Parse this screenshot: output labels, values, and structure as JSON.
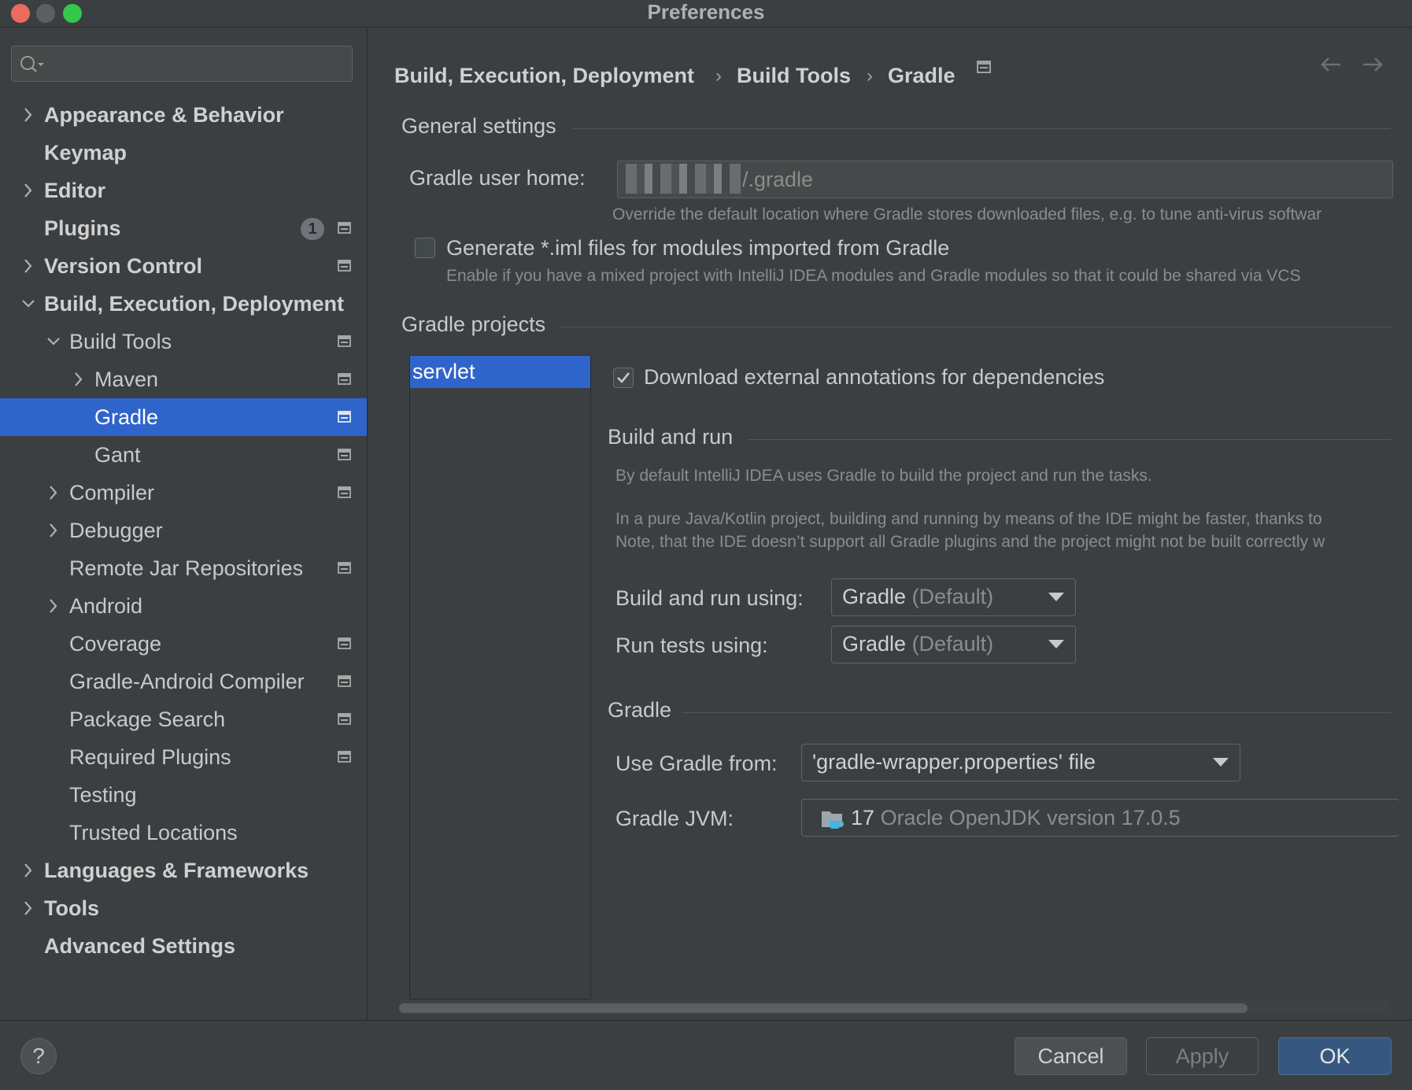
{
  "window": {
    "title": "Preferences"
  },
  "sidebar": {
    "search": {
      "value": "",
      "placeholder": ""
    },
    "items": [
      {
        "label": "Appearance & Behavior",
        "level": 0,
        "expander": "collapsed",
        "bold": true,
        "project_icon": false
      },
      {
        "label": "Keymap",
        "level": 0,
        "expander": "none",
        "bold": true,
        "project_icon": false
      },
      {
        "label": "Editor",
        "level": 0,
        "expander": "collapsed",
        "bold": true,
        "project_icon": false
      },
      {
        "label": "Plugins",
        "level": 0,
        "expander": "none",
        "bold": true,
        "project_icon": true,
        "badge": "1"
      },
      {
        "label": "Version Control",
        "level": 0,
        "expander": "collapsed",
        "bold": true,
        "project_icon": true
      },
      {
        "label": "Build, Execution, Deployment",
        "level": 0,
        "expander": "expanded",
        "bold": true,
        "project_icon": false
      },
      {
        "label": "Build Tools",
        "level": 1,
        "expander": "expanded",
        "bold": false,
        "project_icon": true
      },
      {
        "label": "Maven",
        "level": 2,
        "expander": "collapsed",
        "bold": false,
        "project_icon": true
      },
      {
        "label": "Gradle",
        "level": 2,
        "expander": "none",
        "bold": false,
        "project_icon": true,
        "selected": true
      },
      {
        "label": "Gant",
        "level": 2,
        "expander": "none",
        "bold": false,
        "project_icon": true
      },
      {
        "label": "Compiler",
        "level": 1,
        "expander": "collapsed",
        "bold": false,
        "project_icon": true
      },
      {
        "label": "Debugger",
        "level": 1,
        "expander": "collapsed",
        "bold": false,
        "project_icon": false
      },
      {
        "label": "Remote Jar Repositories",
        "level": 1,
        "expander": "none",
        "bold": false,
        "project_icon": true
      },
      {
        "label": "Android",
        "level": 1,
        "expander": "collapsed",
        "bold": false,
        "project_icon": false
      },
      {
        "label": "Coverage",
        "level": 1,
        "expander": "none",
        "bold": false,
        "project_icon": true
      },
      {
        "label": "Gradle-Android Compiler",
        "level": 1,
        "expander": "none",
        "bold": false,
        "project_icon": true
      },
      {
        "label": "Package Search",
        "level": 1,
        "expander": "none",
        "bold": false,
        "project_icon": true
      },
      {
        "label": "Required Plugins",
        "level": 1,
        "expander": "none",
        "bold": false,
        "project_icon": true
      },
      {
        "label": "Testing",
        "level": 1,
        "expander": "none",
        "bold": false,
        "project_icon": false
      },
      {
        "label": "Trusted Locations",
        "level": 1,
        "expander": "none",
        "bold": false,
        "project_icon": false
      },
      {
        "label": "Languages & Frameworks",
        "level": 0,
        "expander": "collapsed",
        "bold": true,
        "project_icon": false
      },
      {
        "label": "Tools",
        "level": 0,
        "expander": "collapsed",
        "bold": true,
        "project_icon": false
      },
      {
        "label": "Advanced Settings",
        "level": 0,
        "expander": "none",
        "bold": true,
        "project_icon": false
      }
    ]
  },
  "breadcrumb": {
    "items": [
      "Build, Execution, Deployment",
      "Build Tools",
      "Gradle"
    ],
    "separator": "›",
    "back_icon": "arrow-left-icon",
    "forward_icon": "arrow-right-icon"
  },
  "general_settings": {
    "title": "General settings",
    "gradle_user_home_label": "Gradle user home:",
    "gradle_user_home_value": "/.gradle",
    "gradle_user_home_hint": "Override the default location where Gradle stores downloaded files, e.g. to tune anti-virus softwar",
    "generate_iml_label": "Generate *.iml files for modules imported from Gradle",
    "generate_iml_checked": false,
    "generate_iml_hint": "Enable if you have a mixed project with IntelliJ IDEA modules and Gradle modules so that it could be shared via VCS"
  },
  "gradle_projects": {
    "title": "Gradle projects",
    "projects": [
      "servlet"
    ],
    "selected_project": "servlet",
    "download_annotations_label": "Download external annotations for dependencies",
    "download_annotations_checked": true,
    "build_and_run": {
      "title": "Build and run",
      "description1": "By default IntelliJ IDEA uses Gradle to build the project and run the tasks.",
      "description2": "In a pure Java/Kotlin project, building and running by means of the IDE might be faster, thanks to",
      "description3": "Note, that the IDE doesn’t support all Gradle plugins and the project might not be built correctly w",
      "build_run_using_label": "Build and run using:",
      "build_run_using_value": "Gradle",
      "build_run_using_suffix": "(Default)",
      "run_tests_using_label": "Run tests using:",
      "run_tests_using_value": "Gradle",
      "run_tests_using_suffix": "(Default)"
    },
    "gradle": {
      "title": "Gradle",
      "use_gradle_from_label": "Use Gradle from:",
      "use_gradle_from_value": "'gradle-wrapper.properties' file",
      "gradle_jvm_label": "Gradle JVM:",
      "gradle_jvm_version": "17",
      "gradle_jvm_name": "Oracle OpenJDK version 17.0.5",
      "gradle_jvm_icon": "jdk-folder-icon"
    }
  },
  "footer": {
    "help_label": "?",
    "cancel_label": "Cancel",
    "apply_label": "Apply",
    "ok_label": "OK"
  },
  "colors": {
    "background": "#3c3f41",
    "selection": "#2f65ca",
    "primary_button": "#365880",
    "traffic_close": "#ed6a5e",
    "traffic_minimize": "#5f5f5f",
    "traffic_maximize": "#34c84a"
  }
}
